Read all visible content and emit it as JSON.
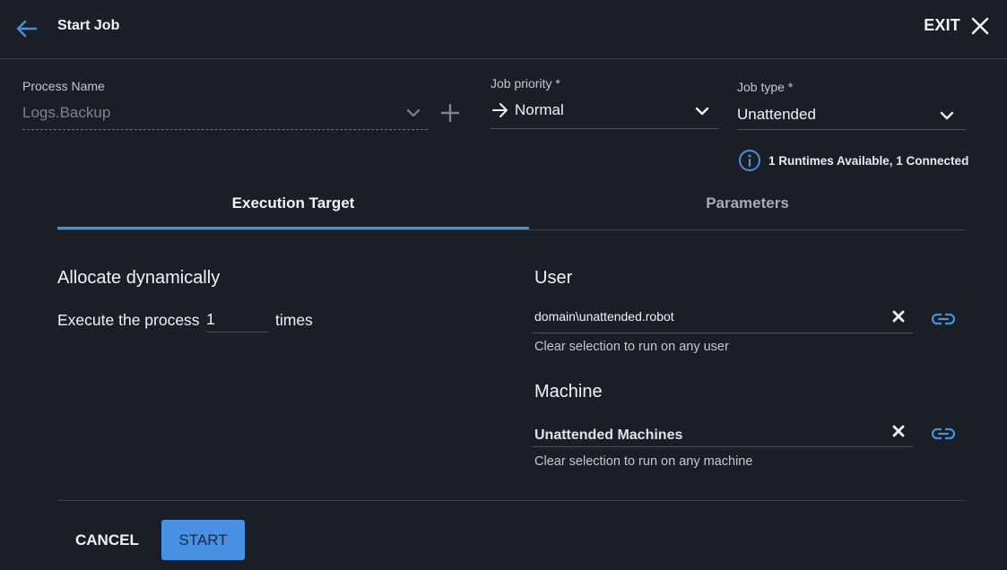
{
  "colors": {
    "background": "#1a1f27",
    "accent": "#4a90d9",
    "start_button_bg": "#4a90e2",
    "divider": "#3a4048",
    "muted_text": "#7d848c"
  },
  "header": {
    "back_icon": "arrow-left-icon",
    "title": "Start Job",
    "exit_label": "EXIT",
    "close_icon": "close-icon"
  },
  "process": {
    "label": "Process Name",
    "value": "Logs.Backup",
    "dropdown_icon": "chevron-down-icon",
    "add_icon": "plus-icon"
  },
  "priority": {
    "label": "Job priority *",
    "icon": "arrow-right-icon",
    "value": "Normal"
  },
  "job_type": {
    "label": "Job type *",
    "value": "Unattended"
  },
  "runtime_info": {
    "icon": "info-icon",
    "text": "1 Runtimes Available, 1 Connected"
  },
  "tabs": [
    {
      "label": "Execution Target",
      "active": true
    },
    {
      "label": "Parameters",
      "active": false
    }
  ],
  "allocation": {
    "title": "Allocate dynamically",
    "execute_prefix": "Execute the process",
    "count": "1",
    "execute_suffix": "times"
  },
  "user": {
    "title": "User",
    "value": "domain\\unattended.robot",
    "hint": "Clear selection to run on any user"
  },
  "machine": {
    "title": "Machine",
    "value": "Unattended Machines",
    "hint": "Clear selection to run on any machine"
  },
  "footer": {
    "cancel_label": "CANCEL",
    "start_label": "START"
  }
}
